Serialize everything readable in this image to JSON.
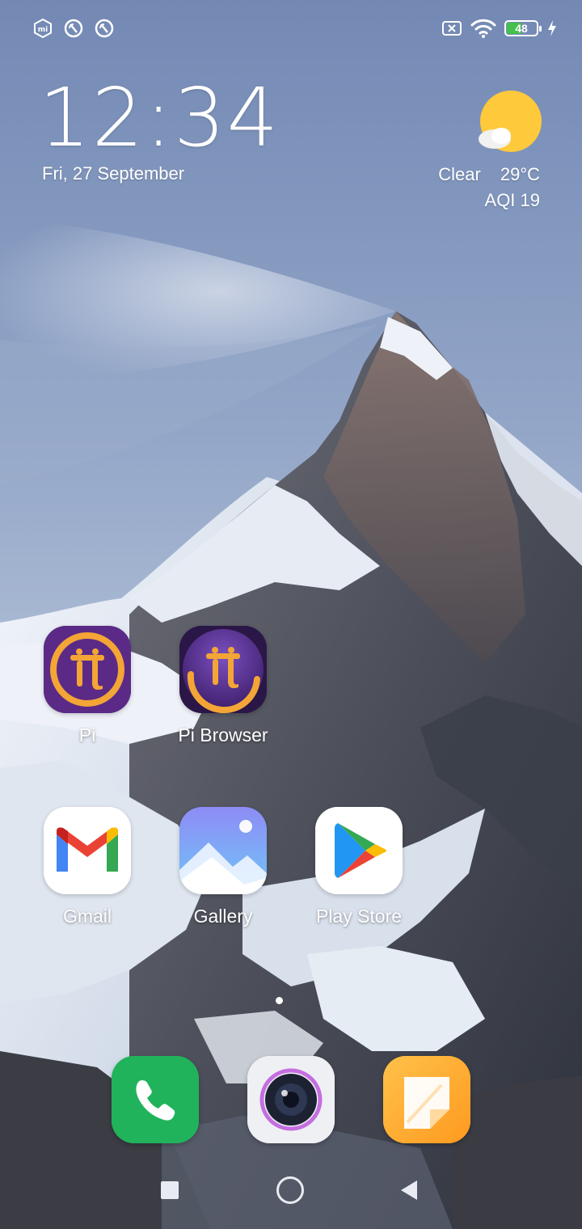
{
  "status_bar": {
    "left_icons": [
      "mi-icon",
      "no-disturb-icon",
      "no-disturb-icon"
    ],
    "right_icons": [
      "no-sim-icon",
      "wifi-icon",
      "battery-icon",
      "charging-icon"
    ],
    "battery_level": "48"
  },
  "clock": {
    "time": "12:34",
    "date": "Fri, 27 September"
  },
  "weather": {
    "condition": "Clear",
    "temperature": "29°C",
    "aqi": "AQI 19",
    "icon": "sun-cloud-icon"
  },
  "apps": [
    {
      "label": "Pi",
      "icon": "pi-network-icon"
    },
    {
      "label": "Pi Browser",
      "icon": "pi-browser-icon"
    },
    {
      "label": "Gmail",
      "icon": "gmail-icon"
    },
    {
      "label": "Gallery",
      "icon": "gallery-icon"
    },
    {
      "label": "Play Store",
      "icon": "play-store-icon"
    }
  ],
  "dock": [
    {
      "icon": "phone-icon"
    },
    {
      "icon": "camera-icon"
    },
    {
      "icon": "notes-icon"
    }
  ],
  "nav": [
    "recents-button",
    "home-button",
    "back-button"
  ],
  "colors": {
    "pi_purple": "#5b2a86",
    "pi_gold": "#f3a536",
    "phone_green": "#21b35b",
    "notes_orange": "#ffac2e",
    "sun_yellow": "#ffc93c"
  }
}
